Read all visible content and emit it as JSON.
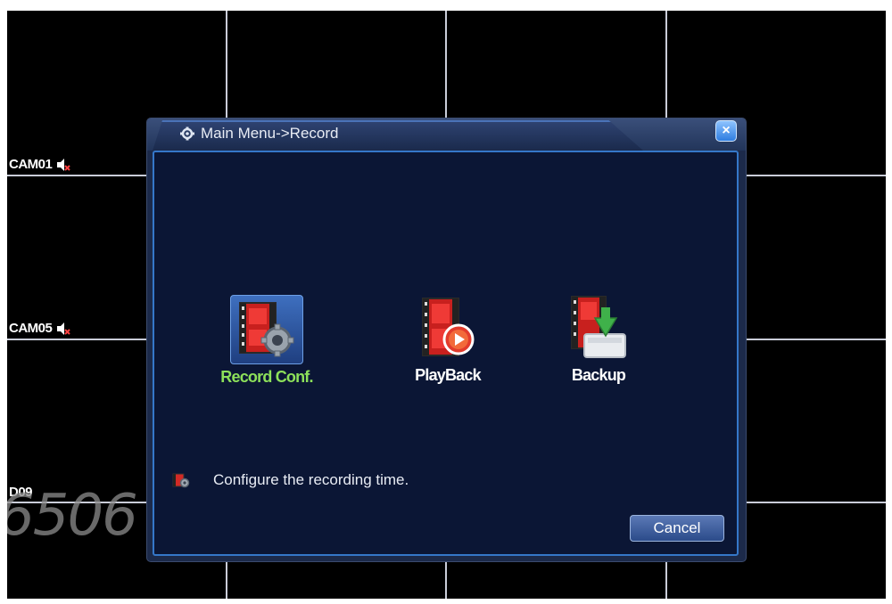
{
  "cameras": [
    {
      "label": "CAM01"
    },
    {
      "label": "CAM05"
    },
    {
      "label": "D09"
    }
  ],
  "watermark": "6506",
  "dialog": {
    "title": "Main Menu->Record",
    "close_label": "×",
    "items": [
      {
        "label": "Record Conf.",
        "icon": "record-conf-icon",
        "selected": true
      },
      {
        "label": "PlayBack",
        "icon": "playback-icon",
        "selected": false
      },
      {
        "label": "Backup",
        "icon": "backup-icon",
        "selected": false
      }
    ],
    "hint": "Configure the recording time.",
    "cancel_label": "Cancel"
  },
  "colors": {
    "active_label": "#8de05a",
    "frame_blue": "#3577c9",
    "content_bg": "#0b1635"
  }
}
